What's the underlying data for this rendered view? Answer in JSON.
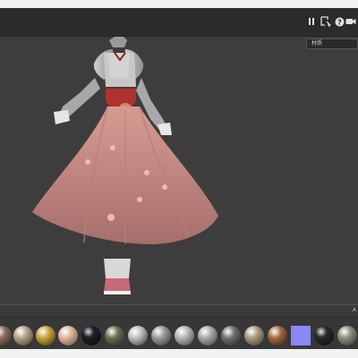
{
  "toolbar": {
    "pause_icon": "pause-icon",
    "select_icon": "select-region-icon",
    "help_icon": "help-icon",
    "camera_icon": "video-camera-icon"
  },
  "dropdown": {
    "label": "材质"
  },
  "bottom_panel": {
    "tab_label": "A"
  },
  "materials": [
    {
      "name": "skin-grain",
      "color": "#8a6d5d"
    },
    {
      "name": "beige-plastic",
      "color": "#b6a487"
    },
    {
      "name": "gold-metal",
      "color": "#c4a43c"
    },
    {
      "name": "skin-peach",
      "color": "#e0b59b"
    },
    {
      "name": "dark-glossy",
      "color": "#1f1f24"
    },
    {
      "name": "olive-matte",
      "color": "#6e6b52"
    },
    {
      "name": "chrome-metal",
      "color": "#c0c0c0"
    },
    {
      "name": "rough-stone",
      "color": "#9a9a9a"
    },
    {
      "name": "grey-matte",
      "color": "#b5b7b2"
    },
    {
      "name": "grey-satin",
      "color": "#a9aba7"
    },
    {
      "name": "dark-grey-rough",
      "color": "#6f6f6f"
    },
    {
      "name": "sand-matte",
      "color": "#a89a82"
    },
    {
      "name": "copper-metal",
      "color": "#a36a3e"
    },
    {
      "name": "lavender-flat",
      "color": "#8a88f5"
    },
    {
      "name": "dark-chrome",
      "color": "#2b2b2b"
    },
    {
      "name": "khaki-matte",
      "color": "#8e8c7c"
    }
  ]
}
